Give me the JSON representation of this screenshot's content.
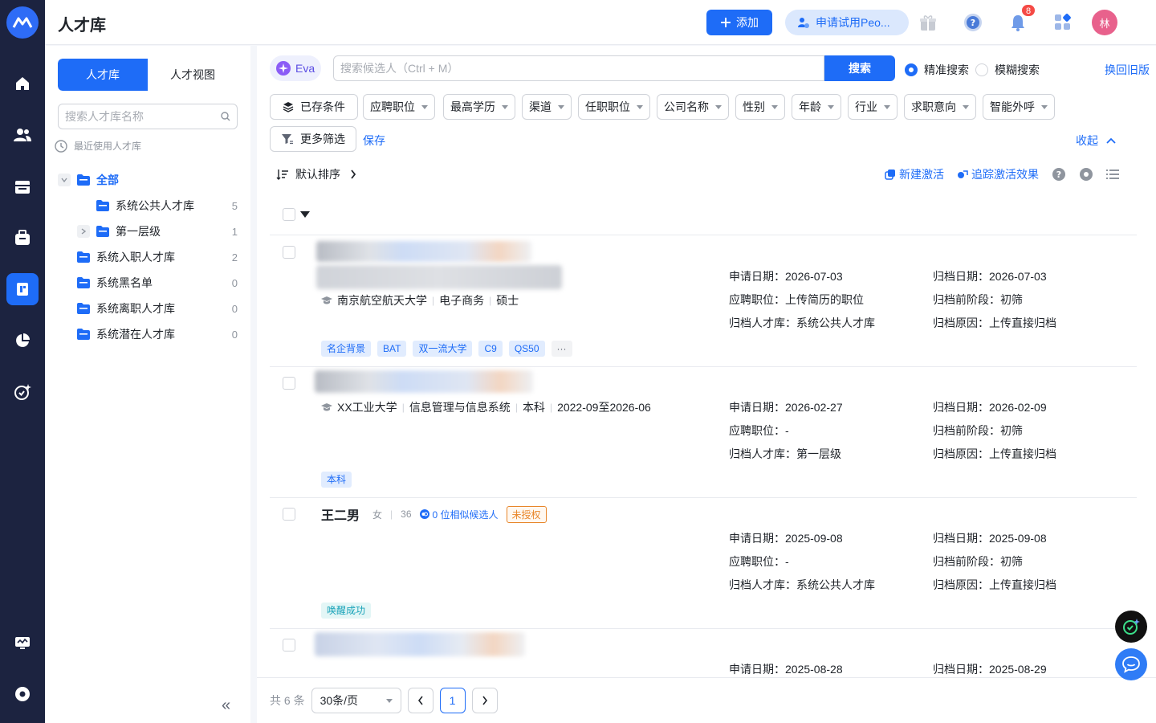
{
  "header": {
    "title": "人才库",
    "add_label": "添加",
    "trial_label": "申请试用Peo...",
    "notification_count": "8",
    "avatar_text": "林"
  },
  "sidebar": {
    "tabs": [
      "人才库",
      "人才视图"
    ],
    "search_placeholder": "搜索人才库名称",
    "recent_label": "最近使用人才库",
    "tree": [
      {
        "label": "全部",
        "count": ""
      },
      {
        "label": "系统公共人才库",
        "count": "5"
      },
      {
        "label": "第一层级",
        "count": "1"
      },
      {
        "label": "系统入职人才库",
        "count": "2"
      },
      {
        "label": "系统黑名单",
        "count": "0"
      },
      {
        "label": "系统离职人才库",
        "count": "0"
      },
      {
        "label": "系统潜在人才库",
        "count": "0"
      }
    ]
  },
  "search": {
    "eva_label": "Eva",
    "placeholder": "搜索候选人（Ctrl + M）",
    "button": "搜索",
    "mode_exact": "精准搜索",
    "mode_fuzzy": "模糊搜索",
    "old_version": "换回旧版"
  },
  "filters": {
    "saved": "已存条件",
    "items": [
      "应聘职位",
      "最高学历",
      "渠道",
      "任职职位",
      "公司名称",
      "性别",
      "年龄",
      "行业",
      "求职意向",
      "智能外呼"
    ],
    "more": "更多筛选",
    "save": "保存",
    "collapse": "收起"
  },
  "toolbar": {
    "sort": "默认排序",
    "new_activation": "新建激活",
    "track_activation": "追踪激活效果"
  },
  "candidates": [
    {
      "edu": [
        "南京航空航天大学",
        "电子商务",
        "硕士"
      ],
      "apply_date": "申请日期：2026-07-03",
      "position": "应聘职位：上传简历的职位",
      "library": "归档人才库：系统公共人才库",
      "archive_date": "归档日期：2026-07-03",
      "stage": "归档前阶段：初筛",
      "reason": "归档原因：上传直接归档",
      "tags": [
        "名企背景",
        "BAT",
        "双一流大学",
        "C9",
        "QS50",
        "···"
      ]
    },
    {
      "edu": [
        "XX工业大学",
        "信息管理与信息系统",
        "本科",
        "2022-09至2026-06"
      ],
      "apply_date": "申请日期：2026-02-27",
      "position": "应聘职位：-",
      "library": "归档人才库：第一层级",
      "archive_date": "归档日期：2026-02-09",
      "stage": "归档前阶段：初筛",
      "reason": "归档原因：上传直接归档",
      "tags": [
        "本科"
      ]
    },
    {
      "name": "王二男",
      "gender": "女",
      "age": "36",
      "similar": "0 位相似候选人",
      "auth": "未授权",
      "apply_date": "申请日期：2025-09-08",
      "position": "应聘职位：-",
      "library": "归档人才库：系统公共人才库",
      "archive_date": "归档日期：2025-09-08",
      "stage": "归档前阶段：初筛",
      "reason": "归档原因：上传直接归档",
      "tags": [
        "唤醒成功"
      ]
    },
    {
      "apply_date": "申请日期：2025-08-28",
      "archive_date": "归档日期：2025-08-29"
    }
  ],
  "pager": {
    "total": "共 6 条",
    "page_size": "30条/页",
    "current": "1"
  },
  "colors": {
    "primary": "#1e6cf7",
    "rail": "#1c2340"
  }
}
